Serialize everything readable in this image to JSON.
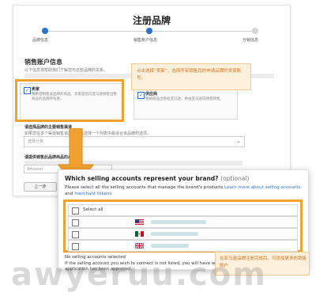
{
  "form": {
    "title": "注册品牌",
    "steps": [
      "品牌信息",
      "销售账户信息",
      "分销信息"
    ],
    "section_title": "销售账户信息",
    "section_hint": "以下信息将帮助我们了解您与这些品牌的关系。",
    "options": [
      {
        "label": "卖家",
        "text": "我希望销售该品牌的商品。卖家是指向亚马逊顾客出售商品的品牌所有者。"
      },
      {
        "label": "供应商",
        "text": "我将商品出售给亚马逊，并由亚马逊向顾客转售。"
      }
    ],
    "select_label": "请选择品牌的主要销售渠道",
    "select_hint": "如果您在多个渠道销售该品牌，请选择一个列表中最适合该品牌的选项。",
    "select_placeholder": "选择分类",
    "asin_label": "请提供销售此品牌商品的ASIN",
    "input_placeholder": "Amazon",
    "prev_button": "上一步"
  },
  "callout_top": "点击选择“卖家”，选择所有销售您的申请品牌的卖家账号。",
  "popup": {
    "title": "Which selling accounts represent your brand?",
    "title_optional": "(optional)",
    "desc": "Please select all the selling accounts that manage the brand's products",
    "link1": "Learn more about selling accounts",
    "link_and": "and",
    "link2": "merchant tokens",
    "select_all": "Select all",
    "note1": "No selling accounts selected",
    "note2": "If the selling account you wish to connect is not listed, you will have an",
    "note3": "application has been approved."
  },
  "callout_bottom": "在亚马逊品牌注册完成后，可添加更多的销售账户",
  "watermark": "awyeruu.com",
  "flags": [
    "us-flag-icon",
    "mx-flag-icon",
    "uk-flag-icon"
  ],
  "colors": {
    "accent": "#f2a12f",
    "link": "#2e6fd6",
    "callout_bg": "#fdf0dc",
    "callout_text": "#d4731b"
  }
}
